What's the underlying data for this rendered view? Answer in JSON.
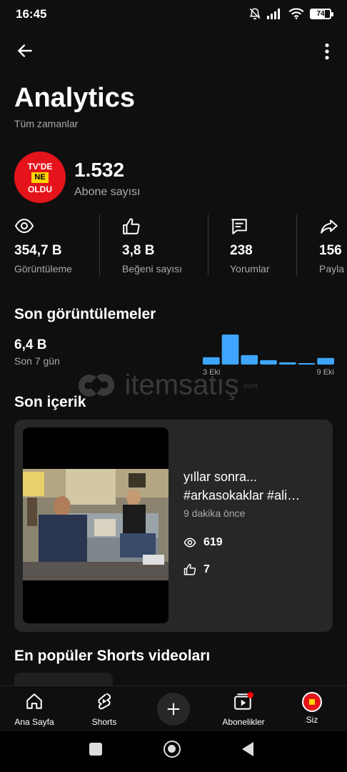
{
  "status_bar": {
    "time": "16:45",
    "battery": "74"
  },
  "header": {
    "title": "Analytics",
    "subtitle": "Tüm zamanlar"
  },
  "channel": {
    "logo_lines": [
      "TV'DE",
      "NE",
      "OLDU"
    ],
    "subscriber_count": "1.532",
    "subscriber_label": "Abone sayısı"
  },
  "stats": [
    {
      "icon": "eye-icon",
      "value": "354,7 B",
      "label": "Görüntüleme"
    },
    {
      "icon": "thumbs-up-icon",
      "value": "3,8 B",
      "label": "Beğeni sayısı"
    },
    {
      "icon": "comment-icon",
      "value": "238",
      "label": "Yorumlar"
    },
    {
      "icon": "share-icon",
      "value": "156",
      "label": "Payla"
    }
  ],
  "recent_views": {
    "title": "Son görüntülemeler",
    "value": "6,4 B",
    "period": "Son 7 gün",
    "chart_data": {
      "type": "bar",
      "categories": [
        "3 Eki",
        "",
        "",
        "",
        "",
        "",
        "9 Eki"
      ],
      "values": [
        10,
        41,
        13,
        6,
        3,
        2,
        9
      ],
      "colors": {
        "bar": "#3ea6ff"
      }
    }
  },
  "watermark": {
    "text": "itemsatış",
    "sub": ".com"
  },
  "recent_content": {
    "title": "Son içerik",
    "video": {
      "title_line1": "yıllar sonra...",
      "title_line2": "#arkasokaklar #ali…",
      "time": "9 dakika önce",
      "views": "619",
      "likes": "7"
    }
  },
  "popular_shorts": {
    "title": "En popüler Shorts videoları"
  },
  "bottom_nav": {
    "home": "Ana Sayfa",
    "shorts": "Shorts",
    "subscriptions": "Abonelikler",
    "you": "Siz"
  },
  "colors": {
    "accent": "#ff0000",
    "chart": "#3ea6ff",
    "background": "#0f0f0f",
    "card": "#272727"
  }
}
